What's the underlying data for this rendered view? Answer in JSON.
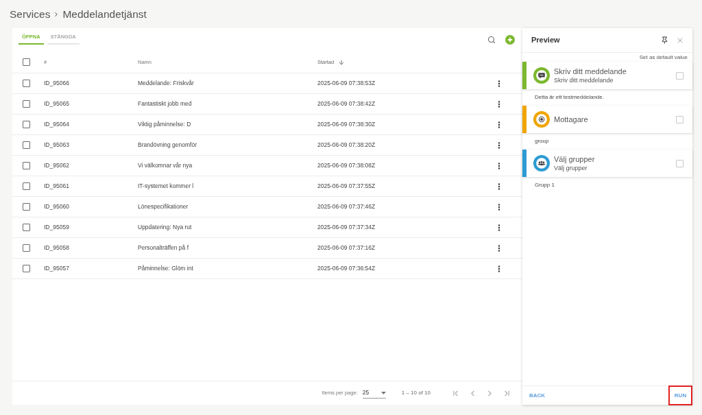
{
  "breadcrumb": [
    "Services",
    "Meddelandetjänst"
  ],
  "tabs": [
    {
      "label": "ÖPPNA",
      "selected": true
    },
    {
      "label": "STÄNGDA",
      "selected": false
    }
  ],
  "table": {
    "select_all_checked": false,
    "columns": [
      {
        "label": "#",
        "sorted": false
      },
      {
        "label": "Namn",
        "sorted": false
      },
      {
        "label": "Startad",
        "sorted": true
      }
    ],
    "rows": [
      {
        "id": "ID_95066",
        "name": "Meddelande: Friskvår",
        "started": "2025-06-09 07:38:53Z",
        "checked": false
      },
      {
        "id": "ID_95065",
        "name": "Fantastiskt jobb med",
        "started": "2025-06-09 07:38:42Z",
        "checked": false
      },
      {
        "id": "ID_95064",
        "name": "Viktig påminnelse: D",
        "started": "2025-06-09 07:38:30Z",
        "checked": false
      },
      {
        "id": "ID_95063",
        "name": "Brandövning genomför",
        "started": "2025-06-09 07:38:20Z",
        "checked": false
      },
      {
        "id": "ID_95062",
        "name": "Vi välkomnar vår nya",
        "started": "2025-06-09 07:38:08Z",
        "checked": false
      },
      {
        "id": "ID_95061",
        "name": "IT-systemet kommer l",
        "started": "2025-06-09 07:37:55Z",
        "checked": false
      },
      {
        "id": "ID_95060",
        "name": "Lönespecifikationer",
        "started": "2025-06-09 07:37:46Z",
        "checked": false
      },
      {
        "id": "ID_95059",
        "name": "Uppdatering: Nya rut",
        "started": "2025-06-09 07:37:34Z",
        "checked": false
      },
      {
        "id": "ID_95058",
        "name": "Personalträffen på f",
        "started": "2025-06-09 07:37:16Z",
        "checked": false
      },
      {
        "id": "ID_95057",
        "name": "Påminnelse: Glöm int",
        "started": "2025-06-09 07:36:54Z",
        "checked": false
      }
    ]
  },
  "pagination": {
    "items_per_page_label": "Items per page:",
    "items_per_page": "25",
    "range": "1 – 10 of 10"
  },
  "preview": {
    "title": "Preview",
    "default_link": "Set as default value",
    "steps": [
      {
        "kind": "message",
        "title": "Skriv ditt meddelande",
        "subtitle": "Skriv ditt meddelande",
        "color": "#7cb82f",
        "checked": false,
        "value": "Detta är ett testmeddelande."
      },
      {
        "kind": "recipient",
        "title": "Mottagare",
        "color": "#f0a500",
        "checked": false,
        "value": "group"
      },
      {
        "kind": "groups",
        "title": "Välj grupper",
        "subtitle": "Välj grupper",
        "color": "#2e9bd3",
        "checked": false,
        "value": "Grupp 1"
      }
    ],
    "back": "BACK",
    "run": {
      "label": "RUN",
      "highlighted": true
    }
  }
}
